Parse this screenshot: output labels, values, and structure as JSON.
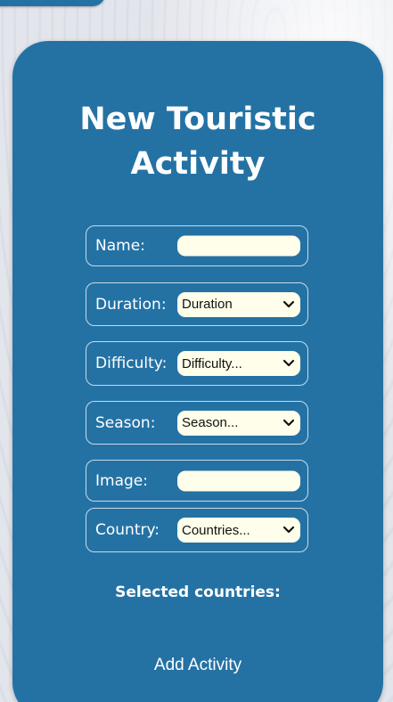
{
  "form": {
    "title": "New Touristic Activity",
    "fields": {
      "name": {
        "label": "Name:",
        "value": ""
      },
      "duration": {
        "label": "Duration:",
        "selected": "Duration"
      },
      "difficulty": {
        "label": "Difficulty:",
        "selected": "Difficulty..."
      },
      "season": {
        "label": "Season:",
        "selected": "Season..."
      },
      "image": {
        "label": "Image:",
        "value": ""
      },
      "country": {
        "label": "Country:",
        "selected": "Countries..."
      }
    },
    "selected_countries_heading": "Selected countries:",
    "submit_label": "Add Activity"
  },
  "theme": {
    "card_color": "#2472a4",
    "input_background": "#fffeea",
    "text_color": "#ffffff"
  }
}
